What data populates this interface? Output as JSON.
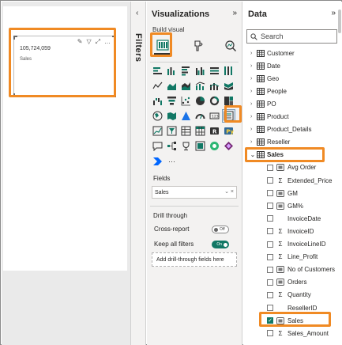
{
  "canvas": {
    "card_value": "105,724,059",
    "card_label": "Sales",
    "header_icons": [
      "pin-icon",
      "filter-icon",
      "focus-icon",
      "more-icon"
    ]
  },
  "filters": {
    "label": "Filters",
    "chevron": "‹"
  },
  "visualizations": {
    "title": "Visualizations",
    "collapse": "»",
    "build_visual": "Build visual",
    "fields_label": "Fields",
    "field_value": "Sales",
    "field_icons": "⌄ ×",
    "drill_through": "Drill through",
    "cross_report": "Cross-report",
    "cross_report_state": "Off",
    "keep_all_filters": "Keep all filters",
    "keep_all_filters_state": "On",
    "drill_drop_placeholder": "Add drill-through fields here",
    "more_visuals": "···",
    "accent_color": "#117865",
    "highlight_color": "#f08a24"
  },
  "data": {
    "title": "Data",
    "collapse": "»",
    "search_placeholder": "Search",
    "tables": [
      {
        "name": "Customer"
      },
      {
        "name": "Date"
      },
      {
        "name": "Geo"
      },
      {
        "name": "People"
      },
      {
        "name": "PO"
      },
      {
        "name": "Product"
      },
      {
        "name": "Product_Details"
      },
      {
        "name": "Reseller"
      },
      {
        "name": "Sales"
      }
    ],
    "sales_fields": [
      {
        "name": "Avg Order",
        "icon": "measure-icon",
        "checked": false
      },
      {
        "name": "Extended_Price",
        "icon": "sigma-icon",
        "checked": false
      },
      {
        "name": "GM",
        "icon": "measure-icon",
        "checked": false
      },
      {
        "name": "GM%",
        "icon": "measure-icon",
        "checked": false
      },
      {
        "name": "InvoiceDate",
        "icon": "none",
        "checked": false
      },
      {
        "name": "InvoiceID",
        "icon": "sigma-icon",
        "checked": false
      },
      {
        "name": "InvoiceLineID",
        "icon": "sigma-icon",
        "checked": false
      },
      {
        "name": "Line_Profit",
        "icon": "sigma-icon",
        "checked": false
      },
      {
        "name": "No of Customers",
        "icon": "measure-icon",
        "checked": false
      },
      {
        "name": "Orders",
        "icon": "measure-icon",
        "checked": false
      },
      {
        "name": "Quantity",
        "icon": "sigma-icon",
        "checked": false
      },
      {
        "name": "ResellerID",
        "icon": "none",
        "checked": false
      },
      {
        "name": "Sales",
        "icon": "measure-icon",
        "checked": true
      },
      {
        "name": "Sales_Amount",
        "icon": "sigma-icon",
        "checked": false
      }
    ]
  }
}
